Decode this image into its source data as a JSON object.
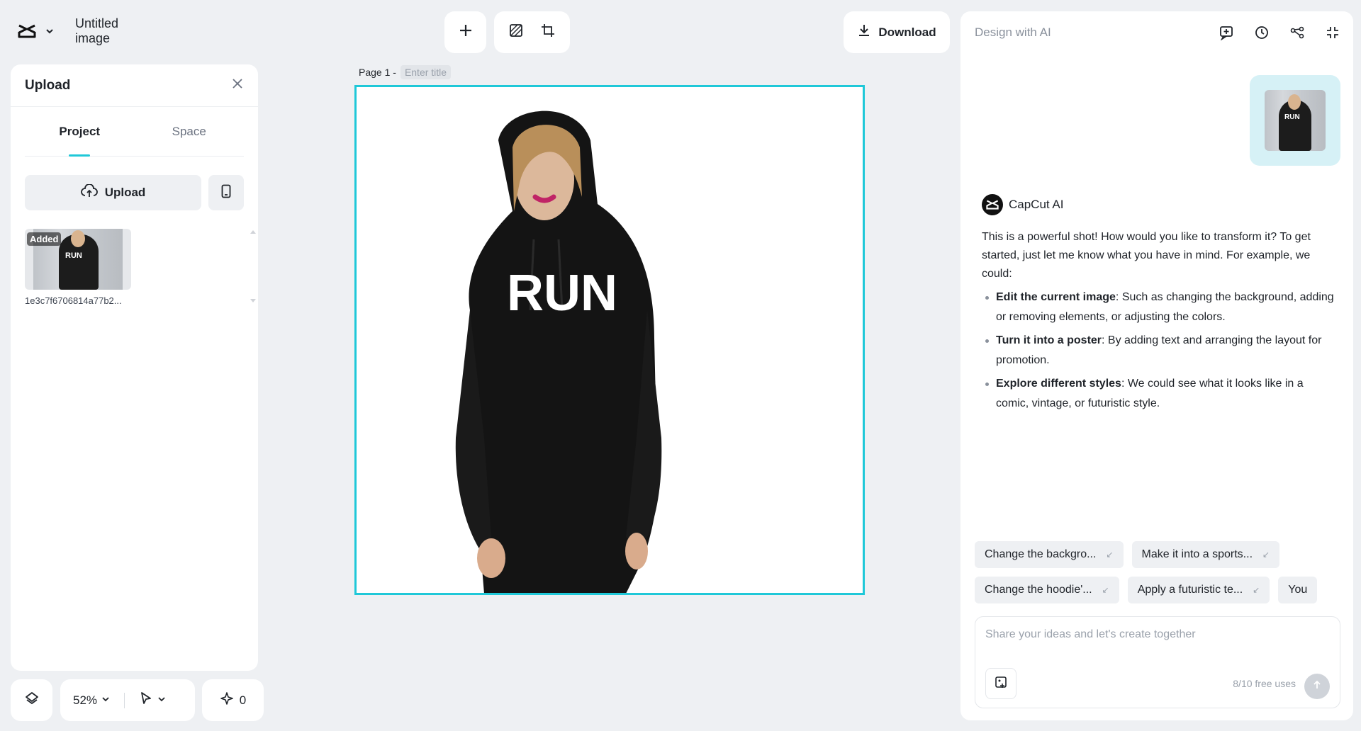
{
  "header": {
    "doc_title": "Untitled image"
  },
  "upload_panel": {
    "title": "Upload",
    "tabs": [
      {
        "label": "Project",
        "active": true
      },
      {
        "label": "Space",
        "active": false
      }
    ],
    "upload_label": "Upload",
    "assets": [
      {
        "name": "1e3c7f6706814a77b2...",
        "badge": "Added",
        "thumb_text": "RUN"
      }
    ]
  },
  "bottom_bar": {
    "zoom": "52%",
    "credits": "0"
  },
  "toolbar": {
    "download_label": "Download"
  },
  "page": {
    "label": "Page 1 -",
    "title_placeholder": "Enter title"
  },
  "canvas": {
    "hoodie_text": "RUN",
    "border_color": "#1fc8d8"
  },
  "ai_panel": {
    "title": "Design with AI",
    "user_image_text": "RUN",
    "sender": "CapCut AI",
    "intro": "This is a powerful shot! How would you like to transform it? To get started, just let me know what you have in mind. For example, we could:",
    "suggestions": [
      {
        "bold": "Edit the current image",
        "text": ": Such as changing the background, adding or removing elements, or adjusting the colors."
      },
      {
        "bold": "Turn it into a poster",
        "text": ": By adding text and arranging the layout for promotion."
      },
      {
        "bold": "Explore different styles",
        "text": ": We could see what it looks like in a comic, vintage, or futuristic style."
      }
    ],
    "chips_row1": [
      "Change the backgro...",
      "Make it into a sports..."
    ],
    "chips_row2": [
      "Change the hoodie'...",
      "Apply a futuristic te...",
      "You"
    ],
    "prompt_placeholder": "Share your ideas and let's create together",
    "free_uses": "8/10 free uses"
  },
  "icons": {
    "logo": "capcut-logo-icon",
    "close": "close-icon",
    "upload": "cloud-upload-icon",
    "mobile": "mobile-icon",
    "layers": "layers-icon",
    "pointer": "pointer-icon",
    "sparkle": "sparkle-icon",
    "add": "plus-icon",
    "download": "download-icon"
  },
  "colors": {
    "accent": "#1fc8d8",
    "background": "#eef0f3"
  }
}
